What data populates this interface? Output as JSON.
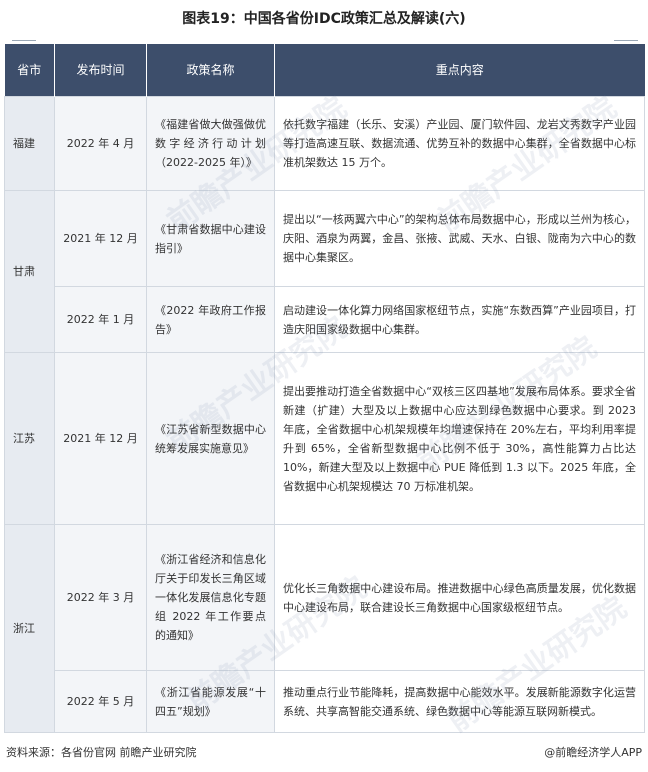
{
  "title": "图表19：中国各省份IDC政策汇总及解读(六)",
  "table": {
    "headers": [
      "省市",
      "发布时间",
      "政策名称",
      "重点内容"
    ],
    "rows": [
      {
        "province": "福建",
        "date": "2022 年 4 月",
        "policy": "《福建省做大做强做优数字经济行动计划（2022-2025 年）》",
        "content": "依托数字福建（长乐、安溪）产业园、厦门软件园、龙岩文秀数字产业园等打造高速互联、数据流通、优势互补的数据中心集群，全省数据中心标准机架数达 15 万个。"
      },
      {
        "province": "甘肃",
        "date": "2021 年 12 月",
        "policy": "《甘肃省数据中心建设指引》",
        "content": "提出以“一核两翼六中心”的架构总体布局数据中心，形成以兰州为核心，庆阳、酒泉为两翼，金昌、张掖、武威、天水、白银、陇南为六中心的数据中心集聚区。"
      },
      {
        "province": "",
        "date": "2022 年 1 月",
        "policy": "《2022 年政府工作报告》",
        "content": "启动建设一体化算力网络国家枢纽节点，实施“东数西算”产业园项目，打造庆阳国家级数据中心集群。"
      },
      {
        "province": "江苏",
        "date": "2021 年 12 月",
        "policy": "《江苏省新型数据中心统筹发展实施意见》",
        "content": "提出要推动打造全省数据中心“双核三区四基地”发展布局体系。要求全省新建（扩建）大型及以上数据中心应达到绿色数据中心要求。到 2023 年底，全省数据中心机架规模年均增速保持在 20%左右，平均利用率提升到 65%，全省新型数据中心比例不低于 30%，高性能算力占比达 10%，新建大型及以上数据中心 PUE 降低到 1.3 以下。2025 年底，全省数据中心机架规模达 70 万标准机架。"
      },
      {
        "province": "浙江",
        "date": "2022 年 3 月",
        "policy": "《浙江省经济和信息化厅关于印发长三角区域一体化发展信息化专题组 2022 年工作要点的通知》",
        "content": "优化长三角数据中心建设布局。推进数据中心绿色高质量发展，优化数据中心建设布局，联合建设长三角数据中心国家级枢纽节点。"
      },
      {
        "province": "",
        "date": "2022 年 5 月",
        "policy": "《浙江省能源发展“十四五”规划》",
        "content": "推动重点行业节能降耗，提高数据中心能效水平。发展新能源数字化运营系统、共享高智能交通系统、绿色数据中心等能源互联网新模式。"
      }
    ]
  },
  "footer": {
    "source": "资料来源：各省份官网 前瞻产业研究院",
    "brand": "@前瞻经济学人APP"
  },
  "watermark": "前瞻产业研究院"
}
